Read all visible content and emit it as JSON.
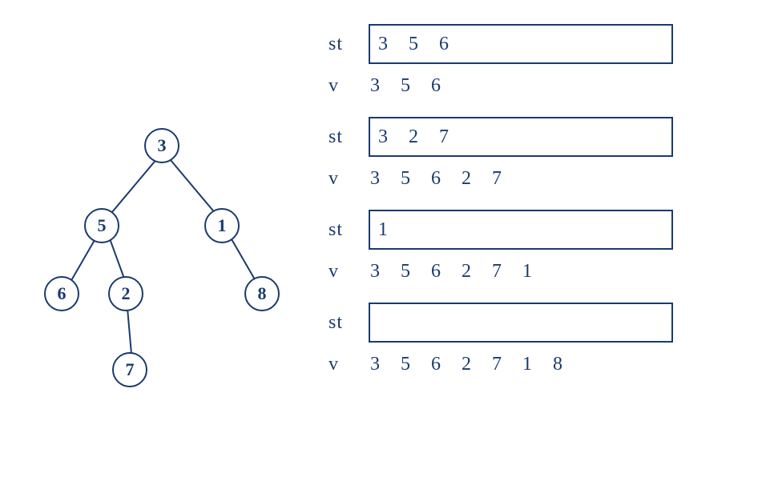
{
  "tree": {
    "nodes": {
      "n3": "3",
      "n5": "5",
      "n1": "1",
      "n6": "6",
      "n2": "2",
      "n8": "8",
      "n7": "7"
    }
  },
  "steps": [
    {
      "type": "st",
      "label": "st",
      "value": "3 5 6"
    },
    {
      "type": "v",
      "label": "v",
      "value": "3 5 6"
    },
    {
      "type": "st",
      "label": "st",
      "value": "3 2 7"
    },
    {
      "type": "v",
      "label": "v",
      "value": "3 5 6 2 7"
    },
    {
      "type": "st",
      "label": "st",
      "value": "1"
    },
    {
      "type": "v",
      "label": "v",
      "value": "3 5 6 2 7 1"
    },
    {
      "type": "st",
      "label": "st",
      "value": ""
    },
    {
      "type": "v",
      "label": "v",
      "value": "3 5 6 2 7 1 8"
    }
  ]
}
